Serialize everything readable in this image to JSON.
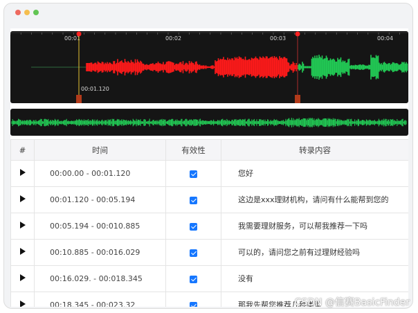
{
  "window": {
    "controls": [
      "close",
      "minimize",
      "maximize"
    ]
  },
  "waveform": {
    "time_ticks": [
      "00:01",
      "00:02",
      "00:03",
      "00:04"
    ],
    "cursor_time": "00:01.120",
    "colors": {
      "selected": "#ff1a1a",
      "unselected": "#22cc55",
      "background": "#151515",
      "cursor": "#e8c233"
    }
  },
  "table": {
    "headers": {
      "index": "#",
      "time": "时间",
      "valid": "有效性",
      "text": "转录内容"
    },
    "rows": [
      {
        "time": "00:00.00 - 00:01.120",
        "valid": true,
        "text": "您好"
      },
      {
        "time": "00:01.120 - 00:05.194",
        "valid": true,
        "text": "这边是xxx理财机构，请问有什么能帮到您的"
      },
      {
        "time": "00:05.194 - 00:010.885",
        "valid": true,
        "text": "我需要理财服务，可以帮我推荐一下吗"
      },
      {
        "time": "00:10.885 - 00:016.029",
        "valid": true,
        "text": "可以的，请问您之前有过理财经验吗"
      },
      {
        "time": "00:16.029. - 00:018.345",
        "valid": true,
        "text": "没有"
      },
      {
        "time": "00:18.345 - 00:023.32",
        "valid": true,
        "text": "那我先帮您推荐几种类型"
      }
    ]
  },
  "watermark": "CSDN @信赛BasicFinder"
}
